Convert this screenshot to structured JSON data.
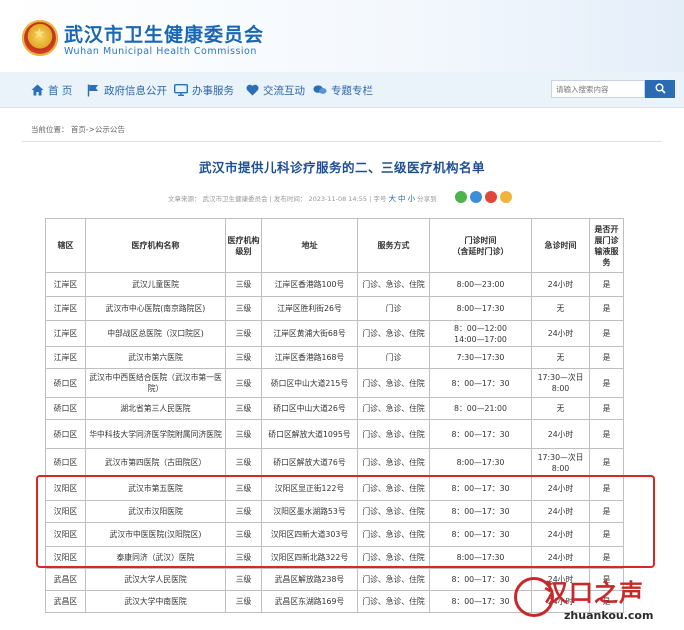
{
  "site": {
    "title": "武汉市卫生健康委员会",
    "subtitle": "Wuhan Municipal Health Commission"
  },
  "nav": {
    "items": [
      {
        "label": "首 页",
        "icon": "home-icon"
      },
      {
        "label": "政府信息公开",
        "icon": "flag-icon"
      },
      {
        "label": "办事服务",
        "icon": "monitor-icon"
      },
      {
        "label": "交流互动",
        "icon": "heart-icon"
      },
      {
        "label": "专题专栏",
        "icon": "chat-icon"
      }
    ]
  },
  "search": {
    "placeholder": "请输入搜索内容"
  },
  "breadcrumb": "当前位置： 首页->公示公告",
  "article": {
    "title": "武汉市提供儿科诊疗服务的二、三级医疗机构名单",
    "meta": "文章来源： 武汉市卫生健康委员会 | 发布时间： 2023-11-08 14:55 | 字号",
    "font_sizes": [
      "大",
      "中",
      "小"
    ],
    "share": "分享到"
  },
  "table": {
    "headers": [
      "辖区",
      "医疗机构名称",
      "医疗机构级别",
      "地址",
      "服务方式",
      "门诊时间\n（含延时门诊）",
      "急诊时间",
      "是否开展门诊输液服务"
    ],
    "rows": [
      [
        "江岸区",
        "武汉儿童医院",
        "三级",
        "江岸区香港路100号",
        "门诊、急诊、住院",
        "8:00—23:00",
        "24小时",
        "是"
      ],
      [
        "江岸区",
        "武汉市中心医院(南京路院区)",
        "三级",
        "江岸区胜利街26号",
        "门诊",
        "8:00—17:30",
        "无",
        "是"
      ],
      [
        "江岸区",
        "中部战区总医院（汉口院区)",
        "三级",
        "江岸区黄浦大街68号",
        "门诊、急诊、住院",
        "8：00—12:00\n14:00—17:00",
        "24小时",
        "是"
      ],
      [
        "江岸区",
        "武汉市第六医院",
        "三级",
        "江岸区香港路168号",
        "门诊",
        "7:30—17:30",
        "无",
        "是"
      ],
      [
        "硚口区",
        "武汉市中西医结合医院（武汉市第一医院）",
        "三级",
        "硚口区中山大道215号",
        "门诊、急诊、住院",
        "8：00—17：30",
        "17:30—次日8:00",
        "是"
      ],
      [
        "硚口区",
        "湖北省第三人民医院",
        "三级",
        "硚口区中山大道26号",
        "门诊、急诊、住院",
        "8：00—21:00",
        "无",
        "是"
      ],
      [
        "硚口区",
        "华中科技大学同济医学院附属同济医院",
        "三级",
        "硚口区解放大道1095号",
        "门诊、急诊、住院",
        "8：00—17：30",
        "24小时",
        "是"
      ],
      [
        "硚口区",
        "武汉市第四医院（古田院区）",
        "三级",
        "硚口区解放大道76号",
        "门诊、急诊、住院",
        "8:00—17:30",
        "17:30—次日8:00",
        "是"
      ],
      [
        "汉阳区",
        "武汉市第五医院",
        "三级",
        "汉阳区显正街122号",
        "门诊、急诊、住院",
        "8：00—17：30",
        "24小时",
        "是"
      ],
      [
        "汉阳区",
        "武汉市汉阳医院",
        "三级",
        "汉阳区墨水湖路53号",
        "门诊、急诊、住院",
        "8：00—17：30",
        "24小时",
        "是"
      ],
      [
        "汉阳区",
        "武汉市中医医院(汉阳院区)",
        "三级",
        "汉阳区四新大道303号",
        "门诊、急诊、住院",
        "8：00—17：30",
        "24小时",
        "是"
      ],
      [
        "汉阳区",
        "泰康同济（武汉）医院",
        "三级",
        "汉阳区四新北路322号",
        "门诊、急诊、住院",
        "8:00—17:30",
        "24小时",
        "是"
      ],
      [
        "武昌区",
        "武汉大学人民医院",
        "三级",
        "武昌区解放路238号",
        "门诊、急诊、住院",
        "8：00—17：30",
        "24小时",
        "是"
      ],
      [
        "武昌区",
        "武汉大学中南医院",
        "三级",
        "武昌区东湖路169号",
        "门诊、急诊、住院",
        "8：00—17：30",
        "24小时",
        "是"
      ]
    ]
  },
  "watermark": {
    "title": "汉口之声",
    "url": "zhuankou.com"
  },
  "colors": {
    "brand": "#1a66b3",
    "nav_bg": "#eaf2fa",
    "highlight_box": "#d9281f",
    "watermark": "#c7282a"
  }
}
